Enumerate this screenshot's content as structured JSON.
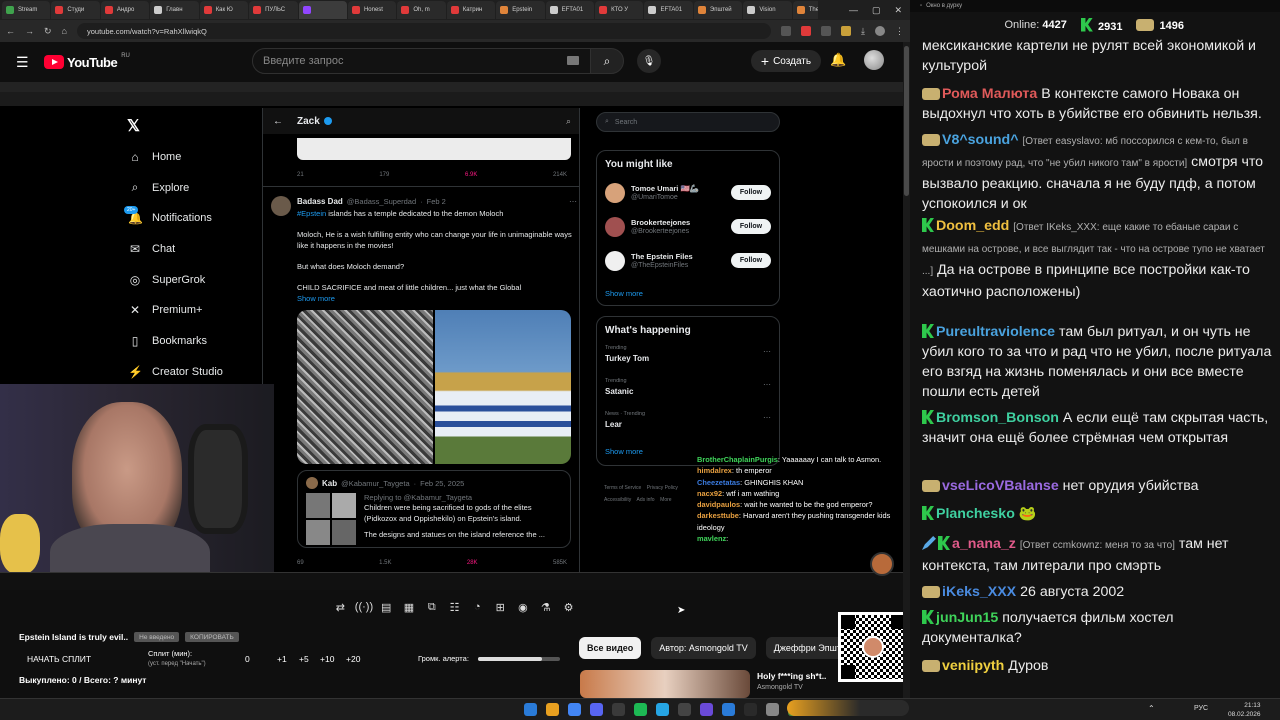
{
  "browser": {
    "tabs": [
      {
        "label": "Stream",
        "color": "#3fa34d"
      },
      {
        "label": "Студи",
        "color": "#e03a3a"
      },
      {
        "label": "Андро",
        "color": "#e03a3a"
      },
      {
        "label": "Главн",
        "color": "#cccccc"
      },
      {
        "label": "Как Ю",
        "color": "#e03a3a"
      },
      {
        "label": "ПУЛЬС",
        "color": "#e03a3a"
      },
      {
        "label": "",
        "color": "#9146ff"
      },
      {
        "label": "Honest",
        "color": "#e03a3a"
      },
      {
        "label": "Oh, m",
        "color": "#e03a3a"
      },
      {
        "label": "Катрин",
        "color": "#e03a3a"
      },
      {
        "label": "Epstein",
        "color": "#e0843a"
      },
      {
        "label": "EFTA01",
        "color": "#cccccc"
      },
      {
        "label": "КТО У",
        "color": "#e03a3a"
      },
      {
        "label": "EFTA01",
        "color": "#cccccc"
      },
      {
        "label": "Эпштей",
        "color": "#e0843a"
      },
      {
        "label": "Vision",
        "color": "#cccccc"
      },
      {
        "label": "The Ep",
        "color": "#e0843a"
      },
      {
        "label": "Письм",
        "color": "#e0843a"
      }
    ],
    "url": "youtube.com/watch?v=RahXllwiqkQ"
  },
  "youtube": {
    "logo_text": "YouTube",
    "region": "RU",
    "search_placeholder": "Введите запрос",
    "create_label": "Создать"
  },
  "x_page": {
    "nav": [
      {
        "icon": "⌂",
        "label": "Home",
        "name": "home"
      },
      {
        "icon": "⌕",
        "label": "Explore",
        "name": "explore"
      },
      {
        "icon": "🔔",
        "label": "Notifications",
        "name": "notifications"
      },
      {
        "icon": "✉",
        "label": "Chat",
        "name": "chat"
      },
      {
        "icon": "◎",
        "label": "SuperGrok",
        "name": "supergrok"
      },
      {
        "icon": "✕",
        "label": "Premium+",
        "name": "premium"
      },
      {
        "icon": "▯",
        "label": "Bookmarks",
        "name": "bookmarks"
      },
      {
        "icon": "⚡",
        "label": "Creator Studio",
        "name": "creator-studio"
      }
    ],
    "notif_count": "20+",
    "profile_header": "Zack",
    "prev_tweet_metrics": [
      "21",
      "179",
      "6.9K",
      "214K"
    ],
    "tweet": {
      "author": "Badass Dad",
      "handle": "@Badass_Superdad",
      "date": "Feb 2",
      "line1_tag": "#Epstein",
      "line1": "islands has a temple dedicated to the demon Moloch",
      "line2": "Moloch, He is a wish fulfilling entity who can change your life in unimaginable ways like it happens in the movies!",
      "line3": "But what does Moloch demand?",
      "line4": "CHILD SACRIFICE and meat of little children... just what the Global",
      "show_more": "Show more",
      "quote_author": "Kab",
      "quote_handle": "@Kabamur_Taygeta",
      "quote_date": "Feb 25, 2025",
      "quote_reply": "Replying to @Kabamur_Taygeta",
      "quote_text": "Children were being sacrificed to gods of the elites (Pidkozox and Oppishekilo) on Epstein's island.",
      "quote_text2": "The designs and statues on the island reference the ...",
      "metrics": [
        "69",
        "1.5K",
        "28K",
        "585K"
      ]
    },
    "sidebar": {
      "search_placeholder": "Search",
      "might_like_title": "You might like",
      "suggestions": [
        {
          "name": "Tomoe Umari 🇺🇸🦾",
          "handle": "@UmariTomoe",
          "color": "#d7a27a"
        },
        {
          "name": "Brookerteejones",
          "handle": "@Brookerteejones",
          "color": "#a05050"
        },
        {
          "name": "The Epstein Files",
          "handle": "@TheEpsteinFiles",
          "color": "#f0f0f0"
        }
      ],
      "follow_label": "Follow",
      "show_more": "Show more",
      "happening_title": "What's happening",
      "trends": [
        {
          "context": "Trending",
          "topic": "Turkey Tom"
        },
        {
          "context": "Trending",
          "topic": "Satanic"
        },
        {
          "context": "News · Trending",
          "topic": "Lear"
        }
      ],
      "footer": [
        "Terms of Service",
        "Privacy Policy",
        "Accessibility",
        "Ads info",
        "More"
      ]
    }
  },
  "overlay_chat": [
    {
      "user": "BrotherChaplainPurgis",
      "color": "#3fd45a",
      "text": "Yaaaaaay I can talk to Asmon."
    },
    {
      "user": "himdalrex",
      "color": "#e8a040",
      "text": "th emperor"
    },
    {
      "user": "Cheezetatas",
      "color": "#3a7be0",
      "text": "GHINGHIS KHAN"
    },
    {
      "user": "nacx92",
      "color": "#e8a040",
      "text": "wtf i am wathing"
    },
    {
      "user": "davidpaulos",
      "color": "#e8a040",
      "text": "wait he wanted to be the god emperor?"
    },
    {
      "user": "darkesttube",
      "color": "#e8a040",
      "text": "Harvard aren't they pushing transgender kids ideology"
    },
    {
      "user": "mavlenz",
      "color": "#3fd45a",
      "text": ""
    }
  ],
  "below_video": {
    "title": "Epstein Island is truly evil..",
    "btn_unknown": "Не введено",
    "btn_copy": "КОПИРОВАТЬ",
    "start_split": "НАЧАТЬ СПЛИТ",
    "split_min_label": "Сплит (мин):",
    "split_min_sub": "(уст. перед \"Начать\")",
    "split_values": [
      "0",
      "+1",
      "+5",
      "+10",
      "+20"
    ],
    "alert_volume": "Громк. алерта:",
    "bought": "Выкуплено: 0 / Всего: ? минут",
    "alert_level": 0.78
  },
  "chips": [
    "Все видео",
    "Автор: Asmongold TV",
    "Джеффри Эпштейн"
  ],
  "rec_video": {
    "title": "Holy f***ing sh*t..",
    "channel": "Asmongold TV"
  },
  "chat_panel": {
    "title": "Окно в дурку",
    "online_label": "Online:",
    "online": "4427",
    "count_k": "2931",
    "count_cat": "1496",
    "messages": [
      {
        "badges": [],
        "nick": "",
        "color": "#ececec",
        "reply": "",
        "text": "мексиканские картели не рулят всей экономикой и культурой"
      },
      {
        "badges": [
          "cat"
        ],
        "nick": "Рома Малюта",
        "color": "#e05a5a",
        "reply": "",
        "text": "В контексте самого Новака он выдохнул что хоть в убийстве его обвинить нельзя."
      },
      {
        "badges": [
          "cat"
        ],
        "nick": "V8^sound^",
        "color": "#4aa3df",
        "reply": "[Ответ easyslavo: мб поссорился с кем-то, был в ярости и поэтому рад, что \"не убил никого там\" в ярости]",
        "text": "смотря что вызвало реакцию. сначала я не буду пдф, а потом успокоился и ок"
      },
      {
        "badges": [
          "k"
        ],
        "nick": "Doom_edd",
        "color": "#f0c040",
        "reply": "[Ответ IKeks_XXX: еще какие то ебаные сараи с мешками на острове, и все выглядит так - что на острове тупо не хватает ...]",
        "text": "Да на острове в принципе все постройки как-то хаотично расположены)"
      },
      {
        "badges": [
          "k"
        ],
        "nick": "Pureultraviolence",
        "color": "#4aa3df",
        "reply": "",
        "text": "там был ритуал, и он чуть не убил кого то за что и рад что не убил, после ритуала его взгяд на жизнь поменялась и они все вместе пошли есть детей"
      },
      {
        "badges": [
          "k"
        ],
        "nick": "Bromson_Bonson",
        "color": "#3fd0a0",
        "reply": "",
        "text": "А если ещё там скрытая часть, значит она ещё более стрёмная чем открытая"
      },
      {
        "badges": [
          "cat"
        ],
        "nick": "vseLicoVBalanse",
        "color": "#9a6ae0",
        "reply": "",
        "text": "нет орудия убийства"
      },
      {
        "badges": [
          "k"
        ],
        "nick": "Planchesko",
        "color": "#3fd0a0",
        "reply": "",
        "text": "🐸"
      },
      {
        "badges": [
          "pencil",
          "k"
        ],
        "nick": "a_nana_z",
        "color": "#e05a8a",
        "reply": "[Ответ ccmkownz: меня то за что]",
        "text": "там нет контекста, там литерали про смэрть"
      },
      {
        "badges": [
          "cat"
        ],
        "nick": "iKeks_XXX",
        "color": "#4a8be0",
        "reply": "",
        "text": "26 августа 2002"
      },
      {
        "badges": [
          "k"
        ],
        "nick": "junJun15",
        "color": "#3fd45a",
        "reply": "",
        "text": "получается фильм хостел документалка?"
      },
      {
        "badges": [
          "cat"
        ],
        "nick": "veniipyth",
        "color": "#f0d040",
        "reply": "",
        "text": "Дуров"
      }
    ]
  },
  "taskbar": {
    "lang": "РУС",
    "time": "21:13",
    "date": "08.02.2026"
  }
}
